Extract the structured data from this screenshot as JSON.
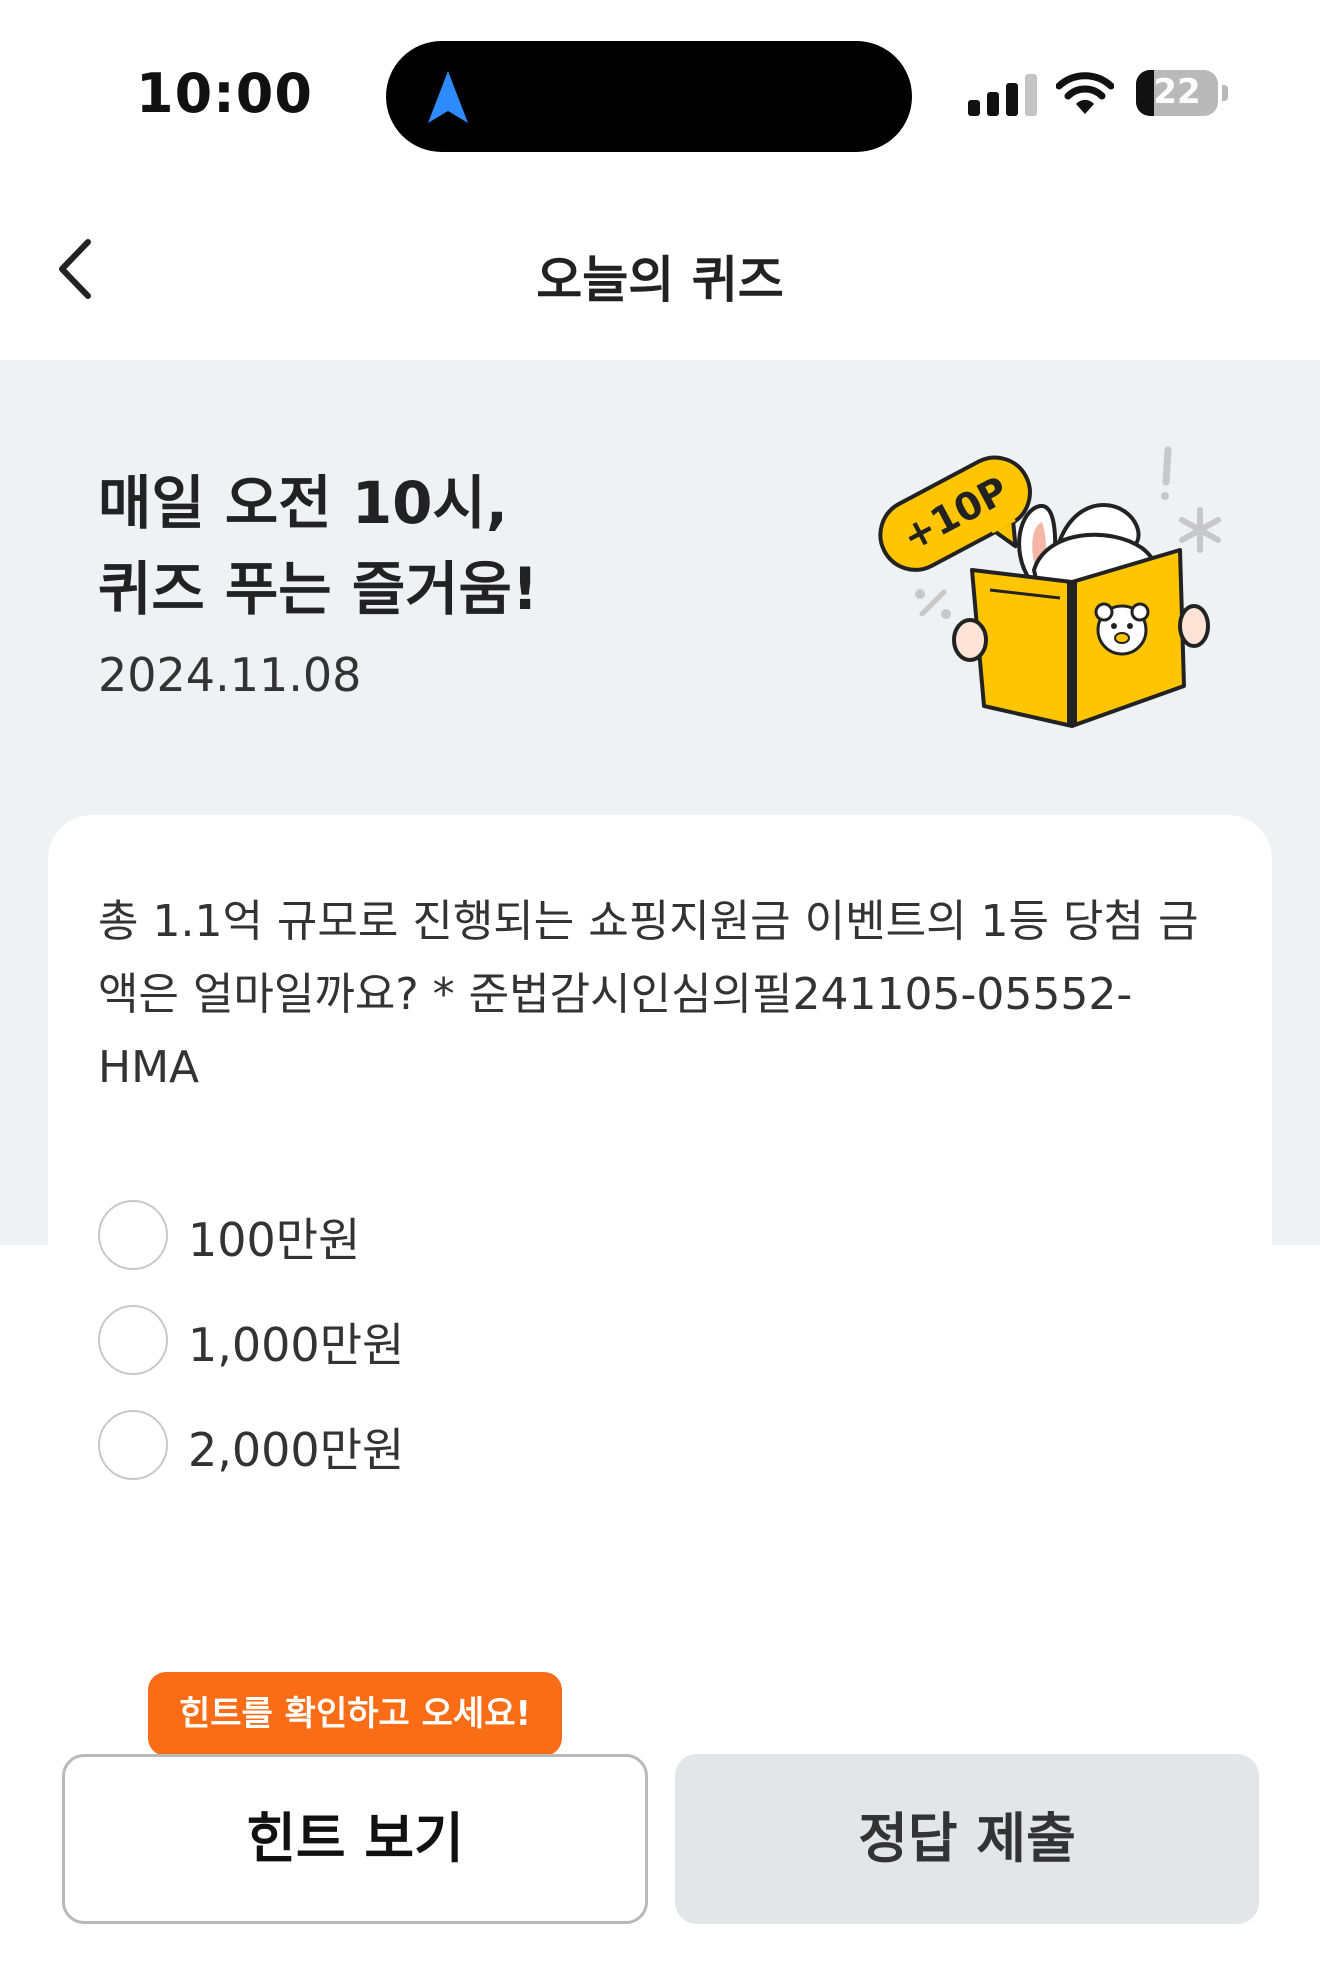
{
  "status": {
    "time": "10:00",
    "battery": "22",
    "battery_level": 0.22
  },
  "header": {
    "title": "오늘의 퀴즈"
  },
  "hero": {
    "title_line1": "매일 오전 10시,",
    "title_line2": "퀴즈 푸는 즐거움!",
    "date": "2024.11.08",
    "badge": "+10P"
  },
  "quiz": {
    "question": "총 1.1억 규모로 진행되는 쇼핑지원금 이벤트의 1등 당첨 금액은 얼마일까요? * 준법감시인심의필241105-05552-HMA",
    "options": [
      {
        "label": "100만원"
      },
      {
        "label": "1,000만원"
      },
      {
        "label": "2,000만원"
      }
    ]
  },
  "footer": {
    "tooltip": "힌트를 확인하고 오세요!",
    "hint_label": "힌트 보기",
    "submit_label": "정답 제출"
  },
  "colors": {
    "accent": "#fb6c16",
    "hero_bg": "#eff1f5",
    "book_yellow": "#ffc600",
    "nav_blue": "#2e8bff"
  }
}
